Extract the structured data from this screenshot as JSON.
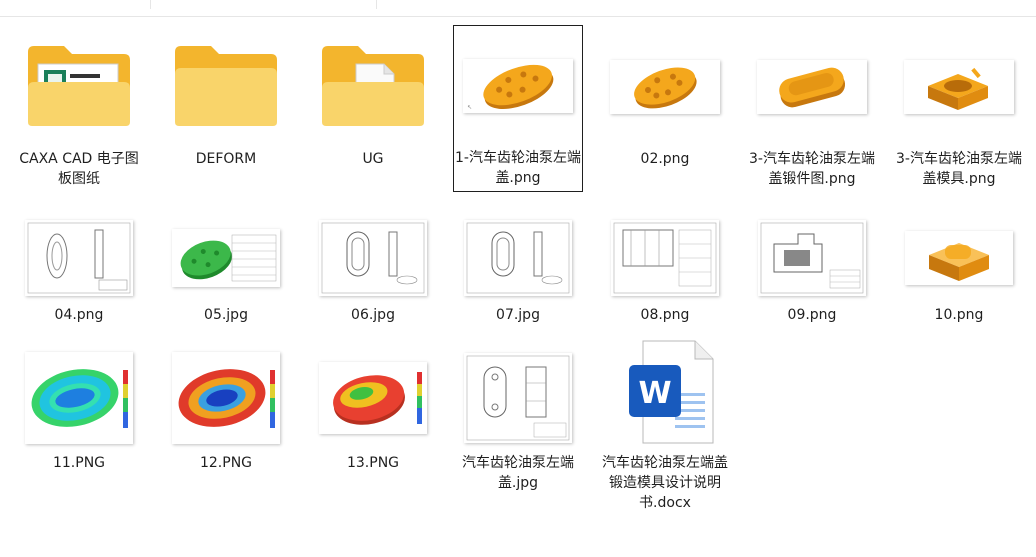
{
  "colors": {
    "folder_back": "#f3b52d",
    "folder_front": "#f9d46a",
    "part_orange": "#f4a71c",
    "part_green": "#3cb84a",
    "word_blue": "#185abd",
    "selection_border": "#1f1f1f"
  },
  "files": [
    {
      "name": "CAXA CAD 电子图板图纸",
      "kind": "folder",
      "icon": "folder-with-drawing-icon"
    },
    {
      "name": "DEFORM",
      "kind": "folder",
      "icon": "folder-icon"
    },
    {
      "name": "UG",
      "kind": "folder",
      "icon": "folder-with-document-icon"
    },
    {
      "name": "1-汽车齿轮油泵左端盖.png",
      "kind": "image",
      "icon": "orange-part-thumbnail",
      "selected": true
    },
    {
      "name": "02.png",
      "kind": "image",
      "icon": "orange-part-thumbnail"
    },
    {
      "name": "3-汽车齿轮油泵左端盖锻件图.png",
      "kind": "image",
      "icon": "orange-forging-thumbnail"
    },
    {
      "name": "3-汽车齿轮油泵左端盖模具.png",
      "kind": "image",
      "icon": "orange-die-thumbnail"
    },
    {
      "name": "04.png",
      "kind": "image",
      "icon": "engineering-drawing-thumbnail"
    },
    {
      "name": "05.jpg",
      "kind": "image",
      "icon": "green-part-drawing-thumbnail"
    },
    {
      "name": "06.jpg",
      "kind": "image",
      "icon": "engineering-drawing-thumbnail"
    },
    {
      "name": "07.jpg",
      "kind": "image",
      "icon": "engineering-drawing-thumbnail"
    },
    {
      "name": "08.png",
      "kind": "image",
      "icon": "assembly-drawing-thumbnail"
    },
    {
      "name": "09.png",
      "kind": "image",
      "icon": "assembly-drawing-thumbnail"
    },
    {
      "name": "10.png",
      "kind": "image",
      "icon": "orange-die-thumbnail"
    },
    {
      "name": "11.PNG",
      "kind": "image",
      "icon": "simulation-plot-thumbnail"
    },
    {
      "name": "12.PNG",
      "kind": "image",
      "icon": "simulation-plot-thumbnail"
    },
    {
      "name": "13.PNG",
      "kind": "image",
      "icon": "simulation-plot-thumbnail"
    },
    {
      "name": "汽车齿轮油泵左端盖.jpg",
      "kind": "image",
      "icon": "engineering-drawing-thumbnail"
    },
    {
      "name": "汽车齿轮油泵左端盖锻造模具设计说明书.docx",
      "kind": "document",
      "icon": "word-document-icon"
    }
  ],
  "word_icon_letter": "W"
}
